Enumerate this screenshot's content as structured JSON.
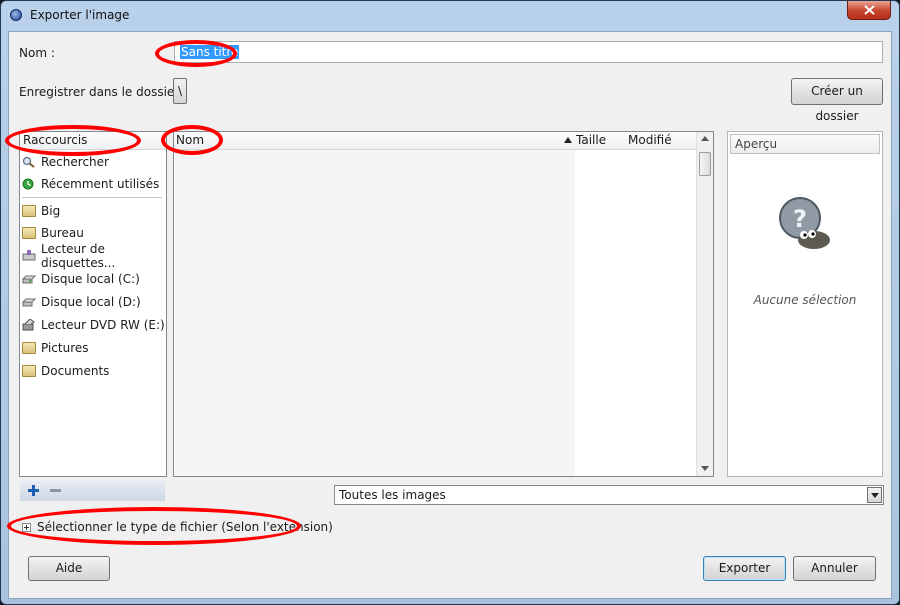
{
  "window": {
    "title": "Exporter l'image"
  },
  "name_row": {
    "label": "Nom :",
    "value": "Sans titre"
  },
  "folder_row": {
    "label": "Enregistrer dans le dossier :",
    "path_button": "\\",
    "create_folder_button": "Créer un dossier"
  },
  "shortcuts": {
    "header": "Raccourcis",
    "items": [
      {
        "label": "Rechercher",
        "icon": "search-icon"
      },
      {
        "label": "Récemment utilisés",
        "icon": "recent-icon"
      },
      {
        "label": "Big",
        "icon": "folder-icon"
      },
      {
        "label": "Bureau",
        "icon": "folder-icon"
      },
      {
        "label": "Lecteur de disquettes...",
        "icon": "floppy-drive-icon"
      },
      {
        "label": "Disque local (C:)",
        "icon": "hard-drive-icon"
      },
      {
        "label": "Disque local (D:)",
        "icon": "hard-drive-icon"
      },
      {
        "label": "Lecteur DVD RW (E:)",
        "icon": "dvd-drive-icon"
      },
      {
        "label": "Pictures",
        "icon": "folder-icon"
      },
      {
        "label": "Documents",
        "icon": "folder-icon"
      }
    ]
  },
  "files": {
    "columns": [
      "Nom",
      "Taille",
      "Modifié"
    ]
  },
  "preview": {
    "header": "Aperçu",
    "empty_text": "Aucune sélection"
  },
  "filter": {
    "selected": "Toutes les images"
  },
  "filetype_expander": {
    "label": "Sélectionner le type de fichier (Selon l'extension)"
  },
  "buttons": {
    "help": "Aide",
    "export": "Exporter",
    "cancel": "Annuler"
  },
  "colors": {
    "annotation_ring": "#ff0000",
    "selection": "#3399ff",
    "title_bar": "#b9d1ea",
    "close_button": "#c7432c"
  }
}
